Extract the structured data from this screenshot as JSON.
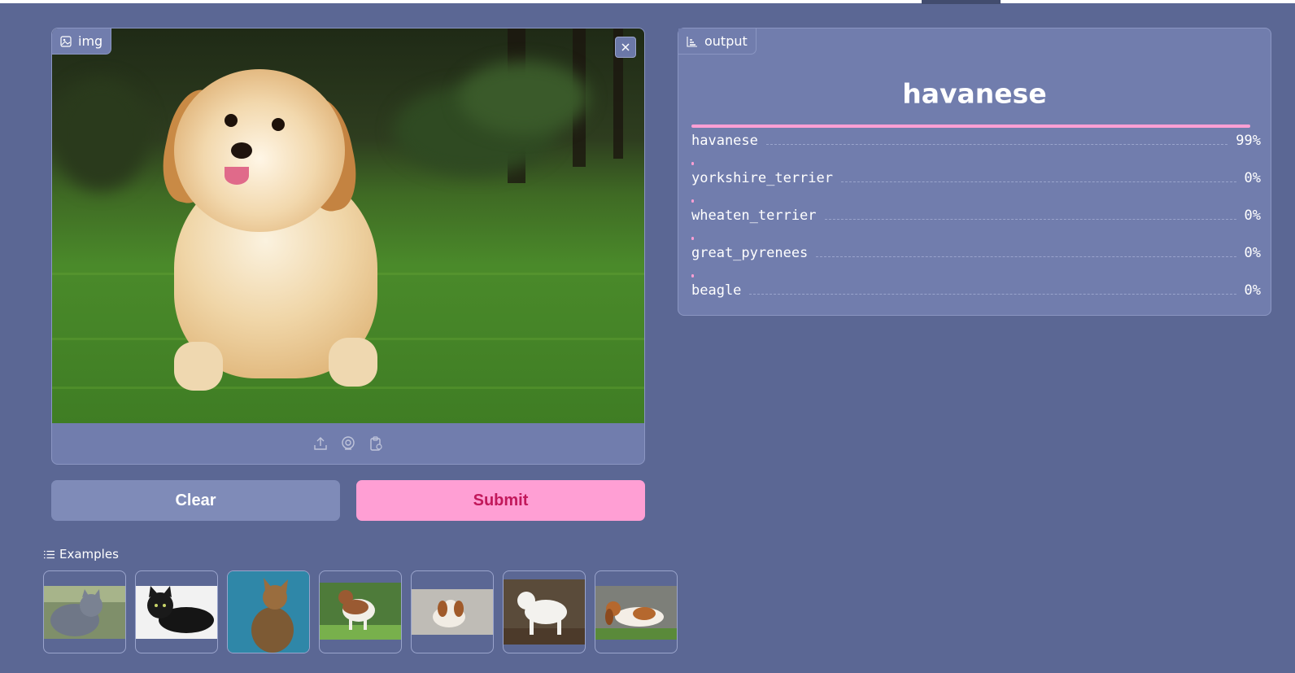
{
  "image_input": {
    "label": "img",
    "label_icon": "image-icon",
    "close_icon": "close-icon",
    "source_icons": [
      "upload-icon",
      "webcam-icon",
      "clipboard-icon"
    ]
  },
  "buttons": {
    "clear_label": "Clear",
    "submit_label": "Submit"
  },
  "examples": {
    "label": "Examples",
    "items": [
      {
        "name": "example-gray-cat"
      },
      {
        "name": "example-black-cat"
      },
      {
        "name": "example-abyssinian-cat"
      },
      {
        "name": "example-saint-bernard"
      },
      {
        "name": "example-cavalier-spaniel"
      },
      {
        "name": "example-white-dog"
      },
      {
        "name": "example-basset-hound"
      }
    ]
  },
  "output": {
    "label": "output",
    "label_icon": "bar-chart-icon",
    "top_label": "havanese",
    "confidences": [
      {
        "label": "havanese",
        "percent": "99%",
        "value": 0.99
      },
      {
        "label": "yorkshire_terrier",
        "percent": "0%",
        "value": 0.0
      },
      {
        "label": "wheaten_terrier",
        "percent": "0%",
        "value": 0.0
      },
      {
        "label": "great_pyrenees",
        "percent": "0%",
        "value": 0.0
      },
      {
        "label": "beagle",
        "percent": "0%",
        "value": 0.0
      }
    ]
  },
  "colors": {
    "background": "#5b6794",
    "panel": "#717dad",
    "accent_pink": "#ff9fd4",
    "submit_text": "#c2185b"
  }
}
